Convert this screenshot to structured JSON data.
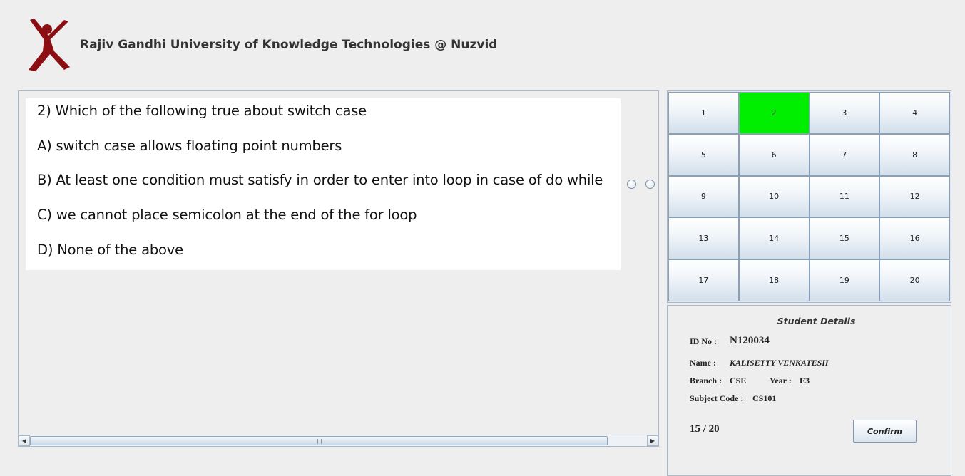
{
  "header": {
    "university_title": "Rajiv Gandhi University of Knowledge Technologies @ Nuzvid",
    "logo_icon": "rgukt-logo-icon",
    "logo_color": "#8b0f12"
  },
  "question": {
    "text": "2) Which of the following true about switch case",
    "options": [
      "A)  switch case allows floating point numbers",
      "B) At least one condition must satisfy in order to enter into loop in case of do while",
      "C) we cannot place semicolon at the end of the for loop",
      "D) None of the above"
    ]
  },
  "navigator": {
    "buttons": [
      "1",
      "2",
      "3",
      "4",
      "5",
      "6",
      "7",
      "8",
      "9",
      "10",
      "11",
      "12",
      "13",
      "14",
      "15",
      "16",
      "17",
      "18",
      "19",
      "20"
    ],
    "active": "2",
    "active_color": "#00ee00"
  },
  "student": {
    "heading": "Student Details",
    "id_label": "ID No :",
    "id_value": "N120034",
    "name_label": "Name :",
    "name_value": "KALISETTY VENKATESH",
    "branch_label": "Branch :",
    "branch_value": "CSE",
    "year_label": "Year :",
    "year_value": "E3",
    "subject_label": "Subject Code :",
    "subject_value": "CS101",
    "progress": "15 / 20",
    "confirm_label": "Confirm"
  }
}
